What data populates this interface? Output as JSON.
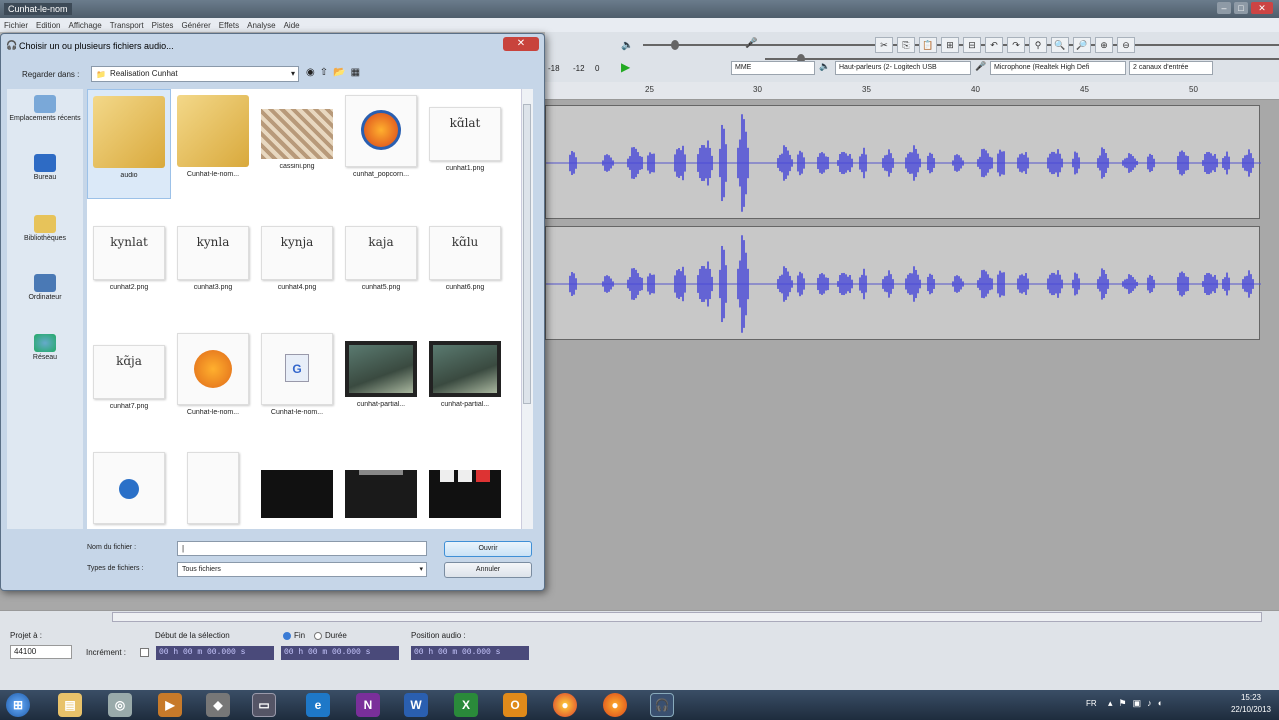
{
  "app": {
    "title": "Cunhat-le-nom",
    "menu": [
      "Fichier",
      "Edition",
      "Affichage",
      "Transport",
      "Pistes",
      "Générer",
      "Effets",
      "Analyse",
      "Aide"
    ],
    "wincontrols": [
      "–",
      "□",
      "✕"
    ]
  },
  "toolbar": {
    "host_value": "MME",
    "playback_device": "Haut-parleurs (2- Logitech USB",
    "recording_device": "Microphone (Realtek High Defi",
    "channels": "2 canaux d'entrée",
    "meter_left": "-18",
    "meter_right": "-12",
    "meter_last": "0"
  },
  "ruler": {
    "ticks": [
      "25",
      "30",
      "35",
      "40",
      "45",
      "50"
    ]
  },
  "dialog": {
    "title": "Choisir un ou plusieurs fichiers audio...",
    "look_in_label": "Regarder dans :",
    "look_in_value": "Realisation Cunhat",
    "places": [
      "Emplacements récents",
      "Bureau",
      "Bibliothèques",
      "Ordinateur",
      "Réseau"
    ],
    "files": [
      {
        "name": "audio",
        "kind": "folder"
      },
      {
        "name": "Cunhat-le-nom...",
        "kind": "folder"
      },
      {
        "name": "cassini.png",
        "kind": "map"
      },
      {
        "name": "cunhat_popcorn...",
        "kind": "firefox"
      },
      {
        "name": "cunhat1.png",
        "kind": "doc",
        "text": "kɑ̃lat"
      },
      {
        "name": "cunhat2.png",
        "kind": "doc",
        "text": "kynlat"
      },
      {
        "name": "cunhat3.png",
        "kind": "doc",
        "text": "kynla"
      },
      {
        "name": "cunhat4.png",
        "kind": "doc",
        "text": "kynja"
      },
      {
        "name": "cunhat5.png",
        "kind": "doc",
        "text": "kaja"
      },
      {
        "name": "cunhat6.png",
        "kind": "doc",
        "text": "kɑ̃lu"
      },
      {
        "name": "cunhat7.png",
        "kind": "doc",
        "text": "kɑ̃ja"
      },
      {
        "name": "Cunhat-le-nom...",
        "kind": "audacity"
      },
      {
        "name": "Cunhat-le-nom...",
        "kind": "gdoc"
      },
      {
        "name": "cunhat-partial...",
        "kind": "video"
      },
      {
        "name": "cunhat-partial...",
        "kind": "video"
      },
      {
        "name": "",
        "kind": "ie-doc"
      },
      {
        "name": "",
        "kind": "blank"
      },
      {
        "name": "",
        "kind": "black"
      },
      {
        "name": "",
        "kind": "black2"
      },
      {
        "name": "",
        "kind": "black3"
      }
    ],
    "filename_label": "Nom du fichier :",
    "filename_value": "|",
    "filetype_label": "Types de fichiers :",
    "filetype_value": "Tous fichiers",
    "open_label": "Ouvrir",
    "cancel_label": "Annuler"
  },
  "bottom": {
    "project_rate_label": "Projet à :",
    "project_rate_value": "44100",
    "snap_label": "Incrément :",
    "selection_start_label": "Début de la sélection",
    "end_label": "Fin",
    "length_label": "Durée",
    "audio_position_label": "Position audio :",
    "time1": "00 h 00 m 00.000 s",
    "time2": "00 h 00 m 00.000 s",
    "time3": "00 h 00 m 00.000 s"
  },
  "taskbar": {
    "lang": "FR",
    "time": "15:23",
    "date": "22/10/2013"
  }
}
